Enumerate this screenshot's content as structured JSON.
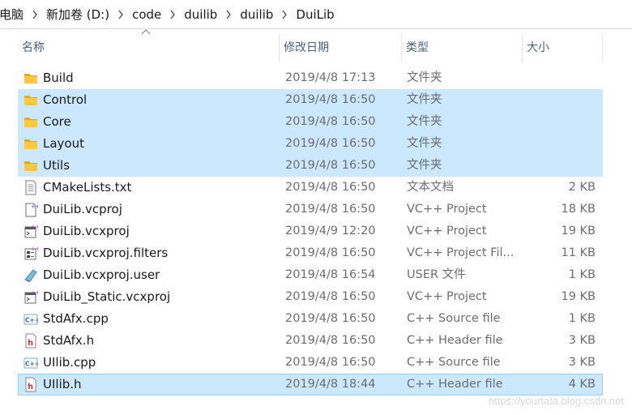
{
  "breadcrumb": [
    "电脑",
    "新加卷 (D:)",
    "code",
    "duilib",
    "duilib",
    "DuiLib"
  ],
  "columns": {
    "name": "名称",
    "date": "修改日期",
    "type": "类型",
    "size": "大小"
  },
  "files": [
    {
      "name": "Build",
      "date": "2019/4/8 17:13",
      "type": "文件夹",
      "size": "",
      "icon": "folder-icon",
      "selected": false
    },
    {
      "name": "Control",
      "date": "2019/4/8 16:50",
      "type": "文件夹",
      "size": "",
      "icon": "folder-icon",
      "selected": true
    },
    {
      "name": "Core",
      "date": "2019/4/8 16:50",
      "type": "文件夹",
      "size": "",
      "icon": "folder-icon",
      "selected": true
    },
    {
      "name": "Layout",
      "date": "2019/4/8 16:50",
      "type": "文件夹",
      "size": "",
      "icon": "folder-icon",
      "selected": true
    },
    {
      "name": "Utils",
      "date": "2019/4/8 16:50",
      "type": "文件夹",
      "size": "",
      "icon": "folder-icon",
      "selected": true
    },
    {
      "name": "CMakeLists.txt",
      "date": "2019/4/8 16:50",
      "type": "文本文档",
      "size": "2 KB",
      "icon": "text-file-icon",
      "selected": false
    },
    {
      "name": "DuiLib.vcproj",
      "date": "2019/4/8 16:50",
      "type": "VC++ Project",
      "size": "18 KB",
      "icon": "vcproj-file-icon",
      "selected": false
    },
    {
      "name": "DuiLib.vcxproj",
      "date": "2019/4/9 12:20",
      "type": "VC++ Project",
      "size": "19 KB",
      "icon": "vcxproj-file-icon",
      "selected": false
    },
    {
      "name": "DuiLib.vcxproj.filters",
      "date": "2019/4/8 16:50",
      "type": "VC++ Project Fil...",
      "size": "11 KB",
      "icon": "filters-file-icon",
      "selected": false
    },
    {
      "name": "DuiLib.vcxproj.user",
      "date": "2019/4/8 16:54",
      "type": "USER 文件",
      "size": "1 KB",
      "icon": "user-file-icon",
      "selected": false
    },
    {
      "name": "DuiLib_Static.vcxproj",
      "date": "2019/4/8 16:50",
      "type": "VC++ Project",
      "size": "19 KB",
      "icon": "vcxproj-file-icon",
      "selected": false
    },
    {
      "name": "StdAfx.cpp",
      "date": "2019/4/8 16:50",
      "type": "C++ Source file",
      "size": "1 KB",
      "icon": "cpp-file-icon",
      "selected": false
    },
    {
      "name": "StdAfx.h",
      "date": "2019/4/8 16:50",
      "type": "C++ Header file",
      "size": "3 KB",
      "icon": "header-file-icon",
      "selected": false
    },
    {
      "name": "UIlib.cpp",
      "date": "2019/4/8 16:50",
      "type": "C++ Source file",
      "size": "3 KB",
      "icon": "cpp-file-icon",
      "selected": false
    },
    {
      "name": "UIlib.h",
      "date": "2019/4/8 18:44",
      "type": "C++ Header file",
      "size": "4 KB",
      "icon": "header-file-icon",
      "selected": true,
      "focused": true
    }
  ],
  "watermark": "https://yourtata.blog.csdn.net",
  "colors": {
    "selection": "#cce8ff",
    "focus_border": "#99d1ff",
    "header_text": "#4c607a",
    "folder": "#ffc83d"
  }
}
